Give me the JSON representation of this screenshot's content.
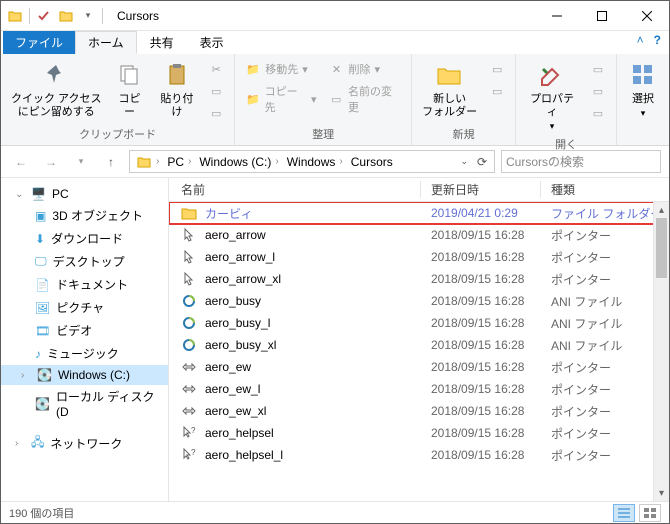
{
  "title": "Cursors",
  "ribbon_tabs": {
    "file": "ファイル",
    "home": "ホーム",
    "share": "共有",
    "view": "表示"
  },
  "ribbon": {
    "clipboard": {
      "pin": "クイック アクセス\nにピン留めする",
      "copy": "コピー",
      "paste": "貼り付け",
      "label": "クリップボード"
    },
    "organize": {
      "move": "移動先",
      "copy_to": "コピー先",
      "delete": "削除",
      "rename": "名前の変更",
      "label": "整理"
    },
    "new_group": {
      "folder": "新しい\nフォルダー",
      "label": "新規"
    },
    "open_group": {
      "props": "プロパティ",
      "label": "開く"
    },
    "select": {
      "select": "選択",
      "label": ""
    }
  },
  "breadcrumbs": [
    "PC",
    "Windows (C:)",
    "Windows",
    "Cursors"
  ],
  "search_placeholder": "Cursorsの検索",
  "columns": {
    "name": "名前",
    "date": "更新日時",
    "type": "種類"
  },
  "nav": {
    "pc": "PC",
    "items": [
      "3D オブジェクト",
      "ダウンロード",
      "デスクトップ",
      "ドキュメント",
      "ピクチャ",
      "ビデオ",
      "ミュージック",
      "Windows (C:)",
      "ローカル ディスク (D"
    ],
    "network": "ネットワーク"
  },
  "files": [
    {
      "name": "カービィ",
      "date": "2019/04/21 0:29",
      "type": "ファイル フォルダー",
      "icon": "folder",
      "highlight": true
    },
    {
      "name": "aero_arrow",
      "date": "2018/09/15 16:28",
      "type": "ポインター",
      "icon": "cursor"
    },
    {
      "name": "aero_arrow_l",
      "date": "2018/09/15 16:28",
      "type": "ポインター",
      "icon": "cursor"
    },
    {
      "name": "aero_arrow_xl",
      "date": "2018/09/15 16:28",
      "type": "ポインター",
      "icon": "cursor"
    },
    {
      "name": "aero_busy",
      "date": "2018/09/15 16:28",
      "type": "ANI ファイル",
      "icon": "ani"
    },
    {
      "name": "aero_busy_l",
      "date": "2018/09/15 16:28",
      "type": "ANI ファイル",
      "icon": "ani"
    },
    {
      "name": "aero_busy_xl",
      "date": "2018/09/15 16:28",
      "type": "ANI ファイル",
      "icon": "ani"
    },
    {
      "name": "aero_ew",
      "date": "2018/09/15 16:28",
      "type": "ポインター",
      "icon": "ew"
    },
    {
      "name": "aero_ew_l",
      "date": "2018/09/15 16:28",
      "type": "ポインター",
      "icon": "ew"
    },
    {
      "name": "aero_ew_xl",
      "date": "2018/09/15 16:28",
      "type": "ポインター",
      "icon": "ew"
    },
    {
      "name": "aero_helpsel",
      "date": "2018/09/15 16:28",
      "type": "ポインター",
      "icon": "help"
    },
    {
      "name": "aero_helpsel_l",
      "date": "2018/09/15 16:28",
      "type": "ポインター",
      "icon": "help"
    }
  ],
  "status": "190 個の項目"
}
